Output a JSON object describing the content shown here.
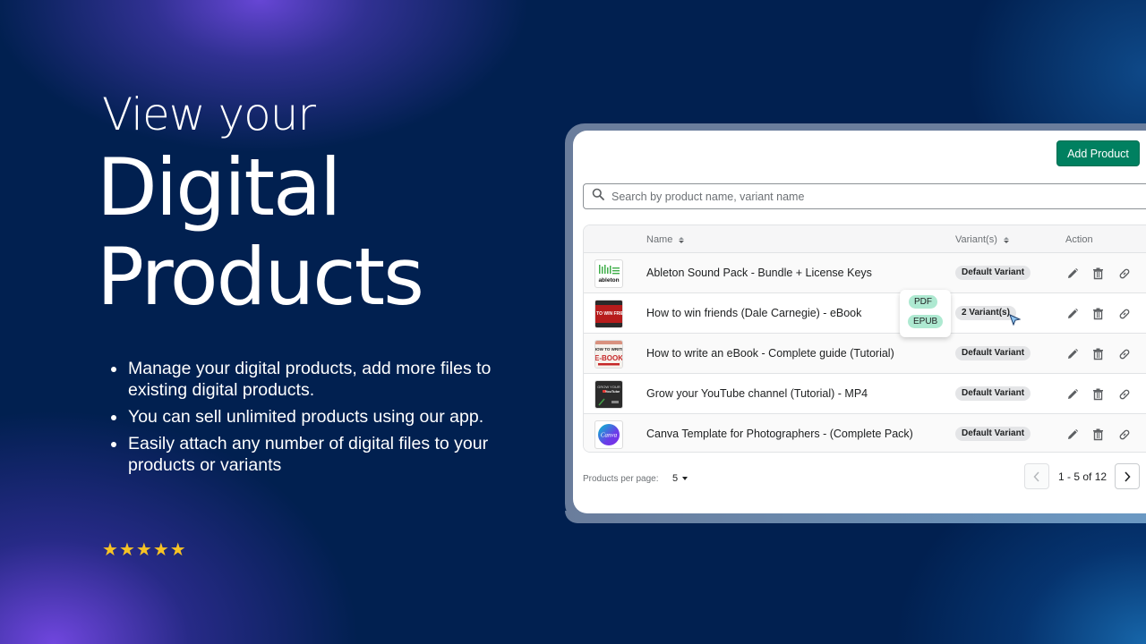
{
  "hero": {
    "line1": "View your",
    "line2": "Digital",
    "line3": "Products"
  },
  "bullets": [
    "Manage your digital products, add more files to existing digital products.",
    "You can sell unlimited products using our app.",
    "Easily attach any number of digital files to your products or variants"
  ],
  "rating": {
    "stars": 5,
    "max": 5,
    "icon": "star-icon",
    "color": "#f7c325"
  },
  "app": {
    "add_product_label": "Add Product",
    "search": {
      "placeholder": "Search by product name, variant name",
      "value": ""
    },
    "columns": {
      "name": "Name",
      "variants": "Variant(s)",
      "action": "Action"
    },
    "rows": [
      {
        "name": "Ableton Sound Pack - Bundle + License Keys",
        "variant": "Default Variant",
        "thumb": "ableton"
      },
      {
        "name": "How to win friends (Dale Carnegie) - eBook",
        "variant": "2 Variant(s)",
        "thumb": "how-to-win-friends"
      },
      {
        "name": "How to write an eBook - Complete guide (Tutorial)",
        "variant": "Default Variant",
        "thumb": "e-book"
      },
      {
        "name": "Grow your YouTube channel (Tutorial) - MP4",
        "variant": "Default Variant",
        "thumb": "youtube"
      },
      {
        "name": "Canva Template for Photographers - (Complete Pack)",
        "variant": "Default Variant",
        "thumb": "canva"
      }
    ],
    "variant_popover": [
      "PDF",
      "EPUB"
    ],
    "action_icons": [
      "edit-icon",
      "delete-icon",
      "link-icon"
    ],
    "footer": {
      "per_page_label": "Products per page:",
      "per_page_value": "5",
      "range": "1 - 5 of 12"
    },
    "colors": {
      "primary": "#008060",
      "chip": "#aee9d1",
      "badge": "#e4e5e7"
    }
  },
  "thumb_text": {
    "ableton": "ableton",
    "friends": "HOW TO WIN FRIENDS",
    "ebook_top": "HOW TO WRITE",
    "ebook": "E-BOOK",
    "youtube_top": "GROW YOUR",
    "youtube": "YouTube",
    "canva": "Canva"
  }
}
